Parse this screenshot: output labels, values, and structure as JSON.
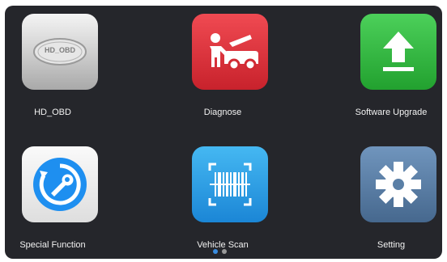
{
  "apps": [
    {
      "label": "HD_OBD",
      "logo_text": "HD_OBD",
      "icon": "hd-obd-logo-icon",
      "color": "#cfcfcf"
    },
    {
      "label": "Diagnose",
      "icon": "mechanic-car-icon",
      "color": "#e2363f"
    },
    {
      "label": "Software Upgrade",
      "icon": "upload-arrow-icon",
      "color": "#2fb53d"
    },
    {
      "label": "Special Function",
      "icon": "wrench-refresh-icon",
      "color": "#1e8ff0"
    },
    {
      "label": "Vehicle Scan",
      "icon": "barcode-scan-icon",
      "color": "#2aa3e8"
    },
    {
      "label": "Setting",
      "icon": "gear-icon",
      "color": "#5a7fa6"
    }
  ],
  "pagination": {
    "pages": 2,
    "current": 1,
    "active_color": "#3a8de0",
    "inactive_color": "#9a9a9a"
  }
}
